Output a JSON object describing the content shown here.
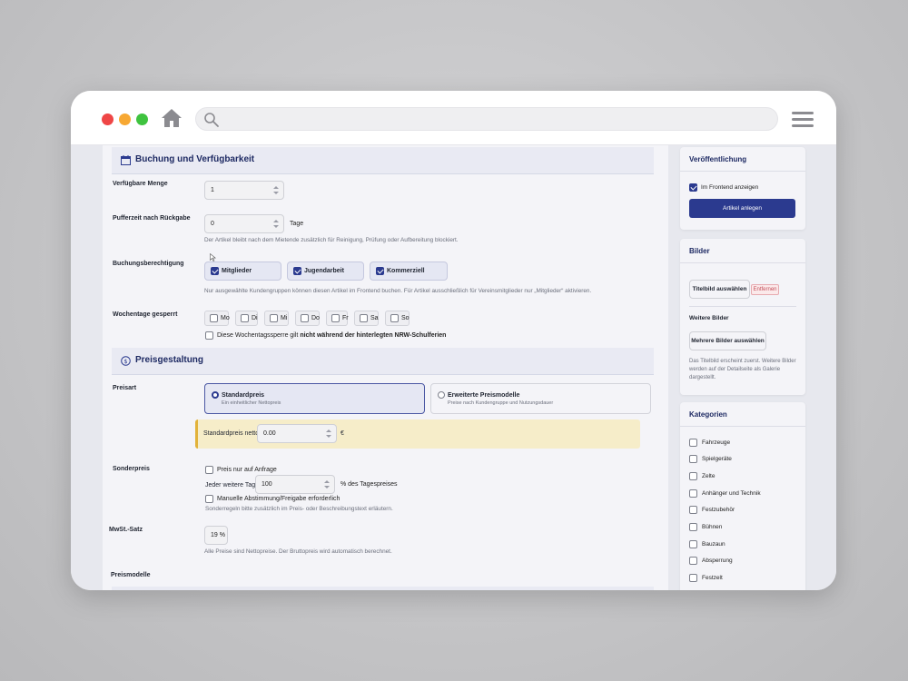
{
  "booking": {
    "section_title": "Buchung und Verfügbarkeit",
    "quantity_label": "Verfügbare Menge",
    "quantity_value": "1",
    "buffer_label": "Pufferzeit nach Rückgabe",
    "buffer_value": "0",
    "buffer_unit": "Tage",
    "buffer_hint": "Der Artikel bleibt nach dem Mietende zusätzlich für Reinigung, Prüfung oder Aufbereitung blockiert.",
    "permission_label": "Buchungsberechtigung",
    "groups": [
      {
        "label": "Mitglieder",
        "checked": true
      },
      {
        "label": "Jugendarbeit",
        "checked": true
      },
      {
        "label": "Kommerziell",
        "checked": true
      }
    ],
    "permission_hint": "Nur ausgewählte Kundengruppen können diesen Artikel im Frontend buchen. Für Artikel ausschließlich für Vereinsmitglieder nur „Mitglieder“ aktivieren.",
    "weekdays_label": "Wochentage gesperrt",
    "weekdays": [
      "Mo",
      "Di",
      "Mi",
      "Do",
      "Fr",
      "Sa",
      "So"
    ],
    "holiday_text_a": "Diese Wochentagssperre gilt",
    "holiday_text_b": "nicht während der hinterlegten NRW-Schulferien"
  },
  "pricing": {
    "section_title": "Preisgestaltung",
    "type_label": "Preisart",
    "options": [
      {
        "title": "Standardpreis",
        "subtitle": "Ein einheitlicher Nettopreis",
        "selected": true
      },
      {
        "title": "Erweiterte Preismodelle",
        "subtitle": "Preise nach Kundengruppe und Nutzungsdauer",
        "selected": false
      }
    ],
    "standard_label": "Standardpreis netto",
    "standard_value": "0.00",
    "currency": "€",
    "special_label": "Sonderpreis",
    "on_request": "Preis nur auf Anfrage",
    "extra_day_label": "Jeder weitere Tag",
    "extra_day_value": "100",
    "extra_day_unit": "% des Tagespreises",
    "manual_approval": "Manuelle Abstimmung/Freigabe erforderlich",
    "special_hint": "Sonderregeln bitte zusätzlich im Preis- oder Beschreibungstext erläutern.",
    "vat_label": "MwSt.-Satz",
    "vat_value": "19 %",
    "vat_hint": "Alle Preise sind Nettopreise. Der Bruttopreis wird automatisch berechnet.",
    "models_label": "Preismodelle"
  },
  "sidebar": {
    "publish": {
      "title": "Veröffentlichung",
      "show_frontend": "Im Frontend anzeigen",
      "show_frontend_checked": true,
      "create_button": "Artikel anlegen"
    },
    "images": {
      "title": "Bilder",
      "choose_title_image": "Titelbild auswählen",
      "remove": "Entfernen",
      "more_label": "Weitere Bilder",
      "choose_more": "Mehrere Bilder auswählen",
      "hint": "Das Titelbild erscheint zuerst. Weitere Bilder werden auf der Detailseite als Galerie dargestellt."
    },
    "categories": {
      "title": "Kategorien",
      "items": [
        "Fahrzeuge",
        "Spielgeräte",
        "Zelte",
        "Anhänger und Technik",
        "Festzubehör",
        "Bühnen",
        "Bauzaun",
        "Absperrung",
        "Festzelt"
      ]
    }
  },
  "colors": {
    "accent": "#2b3a8f",
    "warning_bg": "#f6edc9",
    "warning_border": "#e2b23a"
  }
}
